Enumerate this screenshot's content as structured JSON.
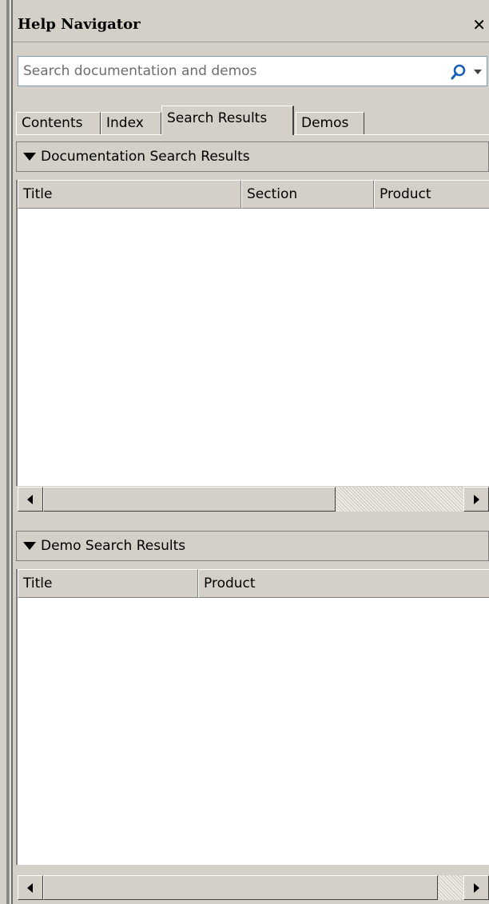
{
  "window": {
    "title": "Help Navigator",
    "close_label": "✕"
  },
  "search": {
    "placeholder": "Search documentation and demos",
    "value": "",
    "icon": "search-icon",
    "dropdown_icon": "chevron-down-icon"
  },
  "tabs": [
    {
      "label": "Contents",
      "active": false
    },
    {
      "label": "Index",
      "active": false
    },
    {
      "label": "Search Results",
      "active": true
    },
    {
      "label": "Demos",
      "active": false
    }
  ],
  "doc_results": {
    "title": "Documentation Search Results",
    "columns": [
      "Title",
      "Section",
      "Product"
    ],
    "rows": []
  },
  "demo_results": {
    "title": "Demo Search Results",
    "columns": [
      "Title",
      "Product"
    ],
    "rows": []
  },
  "colors": {
    "chrome": "#d4d0c8",
    "border": "#808080",
    "input_border": "#7f9db9",
    "search_icon": "#1a5fb4"
  }
}
